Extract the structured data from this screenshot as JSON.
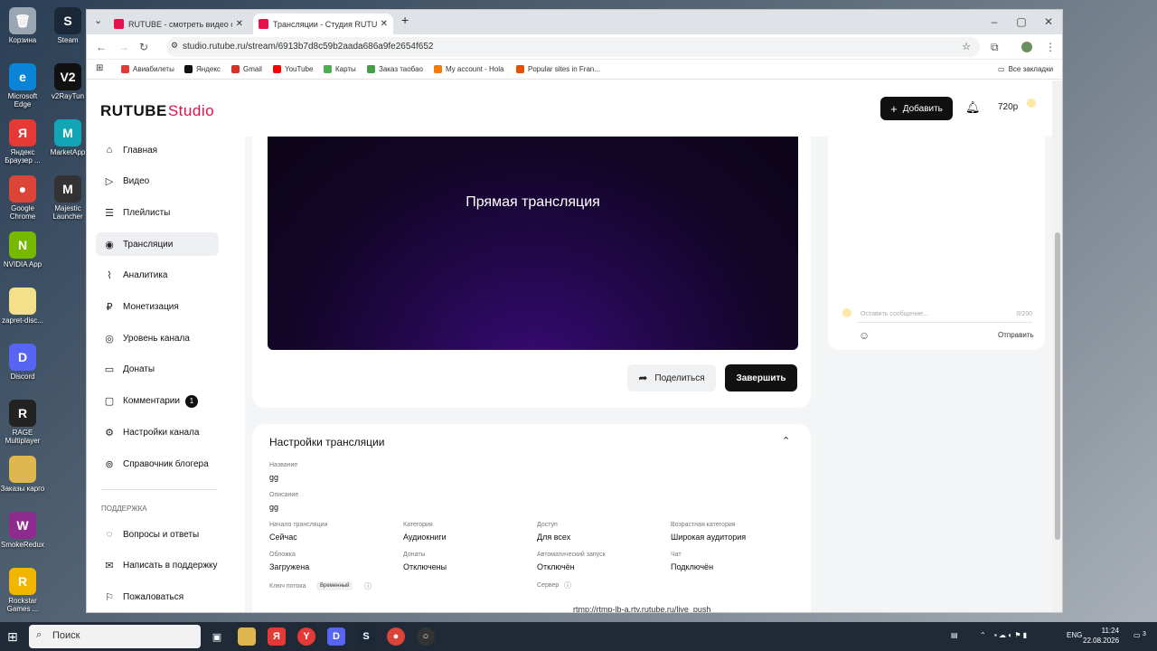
{
  "desktop": {
    "icons": [
      {
        "label": "Корзина",
        "icon": "recycle-bin-icon",
        "color": "#9aa6b2",
        "glyph": "🗑"
      },
      {
        "label": "Steam",
        "icon": "steam-icon",
        "color": "#1b2838",
        "glyph": "S"
      },
      {
        "label": "Microsoft Edge",
        "icon": "edge-icon",
        "color": "#0a84d6",
        "glyph": "e"
      },
      {
        "label": "v2RayTun",
        "icon": "v2raytun-icon",
        "color": "#111",
        "glyph": "V2"
      },
      {
        "label": "Яндекс Браузер ...",
        "icon": "yandex-browser-icon",
        "color": "#e53935",
        "glyph": "Я"
      },
      {
        "label": "MarketApp",
        "icon": "marketapp-icon",
        "color": "#11a5b5",
        "glyph": "M"
      },
      {
        "label": "Google Chrome",
        "icon": "chrome-icon",
        "color": "#db4437",
        "glyph": "●"
      },
      {
        "label": "Majestic Launcher",
        "icon": "majestic-icon",
        "color": "#333",
        "glyph": "M"
      },
      {
        "label": "NVIDIA App",
        "icon": "nvidia-icon",
        "color": "#76b900",
        "glyph": "N"
      },
      {
        "label": "zapret-disc...",
        "icon": "file-icon",
        "color": "#f3e08a",
        "glyph": " "
      },
      {
        "label": "Discord",
        "icon": "discord-icon",
        "color": "#5865f2",
        "glyph": "D"
      },
      {
        "label": "RAGE Multiplayer",
        "icon": "rage-icon",
        "color": "#222",
        "glyph": "R"
      },
      {
        "label": "Заказы карго",
        "icon": "folder-icon",
        "color": "#e0b64f",
        "glyph": " "
      },
      {
        "label": "SmokeRedux",
        "icon": "winrar-icon",
        "color": "#8e2c8e",
        "glyph": "W"
      },
      {
        "label": "Rockstar Games ...",
        "icon": "rockstar-icon",
        "color": "#f2b600",
        "glyph": "R"
      }
    ]
  },
  "browser": {
    "tabs": [
      {
        "title": "RUTUBE - смотреть видео онлайн",
        "active": false
      },
      {
        "title": "Трансляции - Студия RUTUBE",
        "active": true
      }
    ],
    "new_tab": "+",
    "url": "studio.rutube.ru/stream/6913b7d8c59b2aada686a9fe2654f652",
    "bookmarks": [
      {
        "label": "Авиабилеты",
        "color": "#e53935"
      },
      {
        "label": "Яндекс",
        "color": "#111"
      },
      {
        "label": "Gmail",
        "color": "#d93025"
      },
      {
        "label": "YouTube",
        "color": "#ff0000"
      },
      {
        "label": "Карты",
        "color": "#4caf50"
      },
      {
        "label": "Заказ таобао",
        "color": "#43a047"
      },
      {
        "label": "My account - Hola",
        "color": "#f57c00"
      },
      {
        "label": "Popular sites in Fran...",
        "color": "#e65100"
      }
    ],
    "all_bookmarks": "Все закладки"
  },
  "studio": {
    "logo_main": "RUTUBE",
    "logo_studio": "Studio",
    "add_button": "Добавить",
    "resolution": "720p",
    "sidebar": [
      {
        "label": "Главная",
        "icon": "home-icon",
        "glyph": "⌂"
      },
      {
        "label": "Видео",
        "icon": "video-icon",
        "glyph": "▷"
      },
      {
        "label": "Плейлисты",
        "icon": "playlist-icon",
        "glyph": "☰"
      },
      {
        "label": "Трансляции",
        "icon": "broadcast-icon",
        "glyph": "◉"
      },
      {
        "label": "Аналитика",
        "icon": "analytics-icon",
        "glyph": "⌇"
      },
      {
        "label": "Монетизация",
        "icon": "ruble-icon",
        "glyph": "₽"
      },
      {
        "label": "Уровень канала",
        "icon": "level-icon",
        "glyph": "◎"
      },
      {
        "label": "Донаты",
        "icon": "donate-icon",
        "glyph": "▭"
      },
      {
        "label": "Комментарии",
        "icon": "comment-icon",
        "glyph": "▢",
        "badge": "1"
      },
      {
        "label": "Настройки канала",
        "icon": "gear-icon",
        "glyph": "⚙"
      },
      {
        "label": "Справочник блогера",
        "icon": "book-icon",
        "glyph": "⊚"
      }
    ],
    "support_label": "ПОДДЕРЖКА",
    "support_items": [
      {
        "label": "Вопросы и ответы",
        "icon": "faq-icon",
        "glyph": "◌"
      },
      {
        "label": "Написать в поддержку",
        "icon": "mail-icon",
        "glyph": "✉"
      },
      {
        "label": "Пожаловаться",
        "icon": "flag-icon",
        "glyph": "⚐"
      }
    ],
    "player_title": "Прямая трансляция",
    "share_button": "Поделиться",
    "finish_button": "Завершить",
    "chat": {
      "placeholder": "Оставить сообщение...",
      "counter": "0/200",
      "send": "Отправить"
    },
    "settings": {
      "title": "Настройки трансляции",
      "name_label": "Название",
      "name_value": "gg",
      "description_label": "Описание",
      "description_value": "gg",
      "fields": [
        {
          "label": "Начало трансляции",
          "value": "Сейчас"
        },
        {
          "label": "Категория",
          "value": "Аудиокниги"
        },
        {
          "label": "Доступ",
          "value": "Для всех"
        },
        {
          "label": "Возрастная категория",
          "value": "Широкая аудитория"
        },
        {
          "label": "Обложка",
          "value": "Загружена"
        },
        {
          "label": "Донаты",
          "value": "Отключены"
        },
        {
          "label": "Автоматический запуск",
          "value": "Отключён"
        },
        {
          "label": "Чат",
          "value": "Подключён"
        }
      ],
      "stream_key_label": "Ключ потока",
      "stream_key_tag": "Временный",
      "server_label": "Сервер",
      "server_value": "rtmp://rtmp-lb-a.rtv.rutube.ru/live_push"
    }
  },
  "taskbar": {
    "search_placeholder": "Поиск",
    "language": "ENG",
    "time": "11:24",
    "date": "22.08.2026",
    "notifications": "3"
  }
}
